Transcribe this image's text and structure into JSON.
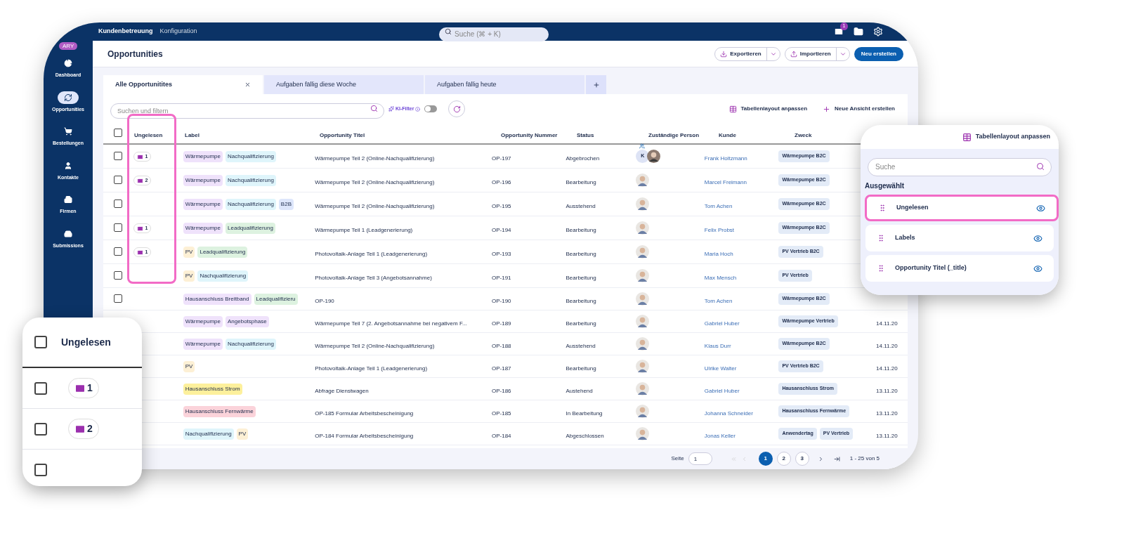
{
  "topbar": {
    "nav": [
      {
        "label": "Kundenbetreuung",
        "selected": true
      },
      {
        "label": "Konfiguration",
        "selected": false
      }
    ],
    "search": {
      "placeholder": "Suche (⌘ + K)"
    },
    "mail_badge": "1"
  },
  "sidebar": {
    "badge": "ARY",
    "items": [
      {
        "label": "Dashboard",
        "kind": "dashboard",
        "selected": false
      },
      {
        "label": "Opportunities",
        "kind": "opportunities",
        "selected": true
      },
      {
        "label": "Bestellungen",
        "kind": "orders",
        "selected": false
      },
      {
        "label": "Kontakte",
        "kind": "contacts",
        "selected": false
      },
      {
        "label": "Firmen",
        "kind": "companies",
        "selected": false
      },
      {
        "label": "Submissions",
        "kind": "submissions",
        "selected": false
      }
    ]
  },
  "page": {
    "title": "Opportunities",
    "actions": [
      {
        "label": "Exportieren",
        "kind": "export"
      },
      {
        "label": "Importieren",
        "kind": "import"
      },
      {
        "label": "Neu erstellen",
        "kind": "primary"
      }
    ]
  },
  "tabs": [
    {
      "label": "Alle Opportunitites",
      "selected": true
    },
    {
      "label": "Aufgaben fällig diese Woche",
      "selected": false
    },
    {
      "label": "Aufgaben fällig heute",
      "selected": false
    }
  ],
  "toolbar": {
    "search": {
      "placeholder": "Suchen und filtern"
    },
    "ki_filter": {
      "label": "KI-Filter",
      "on": false
    },
    "links": [
      "Tabellenlayout anpassen",
      "Neue Ansicht erstellen"
    ]
  },
  "table": {
    "header_checked": false,
    "columns": [
      {
        "label": "Ungelesen",
        "highlighted": true
      },
      {
        "label": "Label",
        "highlighted": false
      },
      {
        "label": "Opportunity Titel",
        "highlighted": false
      },
      {
        "label": "Opportunity Nummer",
        "highlighted": false
      },
      {
        "label": "Status",
        "highlighted": false
      },
      {
        "label": "Zuständige Person",
        "highlighted": false
      },
      {
        "label": "Kunde",
        "highlighted": false
      },
      {
        "label": "Zweck",
        "highlighted": false
      }
    ],
    "rows": [
      {
        "checked": false,
        "unread": "1",
        "labels": [
          {
            "text": "Wärmepumpe",
            "color": "#efe2fb"
          },
          {
            "text": "Nachqualifizierung",
            "color": "#dff5fb"
          }
        ],
        "title": "Wärmepumpe Teil 2 (Online-Nachqualifizierung)",
        "number": "OP-197",
        "status": "Abgebrochen",
        "person": {
          "initial": "K",
          "group": true
        },
        "customer": "Frank Holtzmann",
        "purpose": [
          "Wärmepumpe B2C"
        ]
      },
      {
        "checked": false,
        "unread": "2",
        "labels": [
          {
            "text": "Wärmepumpe",
            "color": "#efe2fb"
          },
          {
            "text": "Nachqualifizierung",
            "color": "#dff5fb"
          }
        ],
        "title": "Wärmepumpe Teil 2 (Online-Nachqualifizierung)",
        "number": "OP-196",
        "status": "Bearbeitung",
        "person": {},
        "customer": "Marcel Freimann",
        "purpose": [
          "Wärmepumpe B2C"
        ]
      },
      {
        "checked": false,
        "labels": [
          {
            "text": "Wärmepumpe",
            "color": "#efe2fb"
          },
          {
            "text": "Nachqualifizierung",
            "color": "#dff5fb"
          },
          {
            "text": "B2B",
            "color": "#dde6fb"
          }
        ],
        "title": "Wärmepumpe Teil 2 (Online-Nachqualifizierung)",
        "number": "OP-195",
        "status": "Ausstehend",
        "person": {},
        "customer": "Tom Achen",
        "purpose": [
          "Wärmepumpe B2C"
        ]
      },
      {
        "checked": false,
        "unread": "1",
        "labels": [
          {
            "text": "Wärmepumpe",
            "color": "#efe2fb"
          },
          {
            "text": "Leadqualifizierung",
            "color": "#ddf2e0"
          }
        ],
        "title": "Wärmepumpe Teil 1 (Leadgenerierung)",
        "number": "OP-194",
        "status": "Bearbeitung",
        "person": {},
        "customer": "Felix Probst",
        "purpose": [
          "Wärmepumpe B2C"
        ]
      },
      {
        "checked": false,
        "unread": "1",
        "labels": [
          {
            "text": "PV",
            "color": "#fdf0d5"
          },
          {
            "text": "Leadqualifizierung",
            "color": "#ddf2e0"
          }
        ],
        "title": "Photovoltaik-Anlage Teil 1 (Leadgenerierung)",
        "number": "OP-193",
        "status": "Bearbeitung",
        "person": {},
        "customer": "Maria Hoch",
        "purpose": [
          "PV Vertrieb B2C"
        ]
      },
      {
        "checked": false,
        "labels": [
          {
            "text": "PV",
            "color": "#fdf0d5"
          },
          {
            "text": "Nachqualifizierung",
            "color": "#dff5fb"
          }
        ],
        "title": "Photovoltaik-Anlage Teil 3 (Angebotsannahme)",
        "number": "OP-191",
        "status": "Bearbeitung",
        "person": {},
        "customer": "Max Mensch",
        "purpose": [
          "PV Vertrieb"
        ]
      },
      {
        "checked": false,
        "labels": [
          {
            "text": "Hausanschluss Breitband",
            "color": "#efe2fb"
          },
          {
            "text": "Leadqualifizieru",
            "color": "#ddf2e0"
          }
        ],
        "title": "OP-190",
        "number": "OP-190",
        "status": "Bearbeitung",
        "person": {},
        "customer": "Tom Achen",
        "purpose": [
          "Wärmepumpe B2C"
        ]
      },
      {
        "labels": [
          {
            "text": "Wärmepumpe",
            "color": "#efe2fb"
          },
          {
            "text": "Angebotsphase",
            "color": "#efe2fb"
          }
        ],
        "title": "Wärmepumpe Teil 7 (2. Angebotsannahme bei negativem F...",
        "number": "OP-189",
        "status": "Bearbeitung",
        "person": {},
        "customer": "Gabriel Huber",
        "purpose": [
          "Wärmepumpe Vertrieb"
        ],
        "date": "14.11.20"
      },
      {
        "labels": [
          {
            "text": "Wärmepumpe",
            "color": "#efe2fb"
          },
          {
            "text": "Nachqualifizierung",
            "color": "#dff5fb"
          }
        ],
        "title": "Wärmepumpe Teil 2 (Online-Nachqualifizierung)",
        "number": "OP-188",
        "status": "Ausstehend",
        "person": {},
        "customer": "Klaus Durr",
        "purpose": [
          "Wärmepumpe B2C"
        ],
        "date": "14.11.20"
      },
      {
        "labels": [
          {
            "text": "PV",
            "color": "#fdf0d5"
          }
        ],
        "title": "Photovoltaik-Anlage Teil 1 (Leadgenerierung)",
        "number": "OP-187",
        "status": "Bearbeitung",
        "person": {},
        "customer": "Ulrike Walter",
        "purpose": [
          "PV Vertrieb B2C"
        ],
        "date": "14.11.20"
      },
      {
        "labels": [
          {
            "text": "Hausanschluss Strom",
            "color": "#fdf09c"
          }
        ],
        "title": "Abfrage Dienstwagen",
        "number": "OP-186",
        "status": "Austehend",
        "person": {},
        "customer": "Gabriel Huber",
        "purpose": [
          "Hausanschluss Strom"
        ],
        "date": "13.11.20"
      },
      {
        "labels": [
          {
            "text": "Hausanschluss Fernwärme",
            "color": "#fbd3da"
          }
        ],
        "title": "OP-185 Formular Arbeitsbescheinigung",
        "number": "OP-185",
        "status": "In Bearbeitung",
        "person": {},
        "customer": "Johanna Schneider",
        "purpose": [
          "Hausanschluss Fernwärme"
        ],
        "date": "13.11.20"
      },
      {
        "labels": [
          {
            "text": "Nachqualifizierung",
            "color": "#dff5fb"
          },
          {
            "text": "PV",
            "color": "#fdf0d5"
          }
        ],
        "title": "OP-184 Formular Arbeitsbescheinigung",
        "number": "OP-184",
        "status": "Abgeschlossen",
        "person": {},
        "customer": "Jonas Keller",
        "purpose": [
          "Anwendertag",
          "PV Vertrieb"
        ],
        "date": "13.11.20"
      }
    ]
  },
  "pagination": {
    "label": "Seite",
    "value": "1",
    "pages": [
      {
        "label": "1",
        "selected": true
      },
      {
        "label": "2",
        "selected": false
      },
      {
        "label": "3",
        "selected": false
      }
    ],
    "range": "1 - 25 von 5"
  },
  "left_callout": {
    "column": "Ungelesen",
    "header_checked": false,
    "rows": [
      {
        "checked": false,
        "unread": "1"
      },
      {
        "checked": false,
        "unread": "2"
      },
      {
        "checked": false
      }
    ]
  },
  "right_callout": {
    "title": "Tabellenlayout anpassen",
    "search": {
      "placeholder": "Suche"
    },
    "section": "Ausgewählt",
    "items": [
      {
        "label": "Ungelesen",
        "visible": true,
        "highlighted": true
      },
      {
        "label": "Labels",
        "visible": true,
        "highlighted": false
      },
      {
        "label": "Opportunity Titel (_title)",
        "visible": true,
        "highlighted": false
      }
    ]
  }
}
